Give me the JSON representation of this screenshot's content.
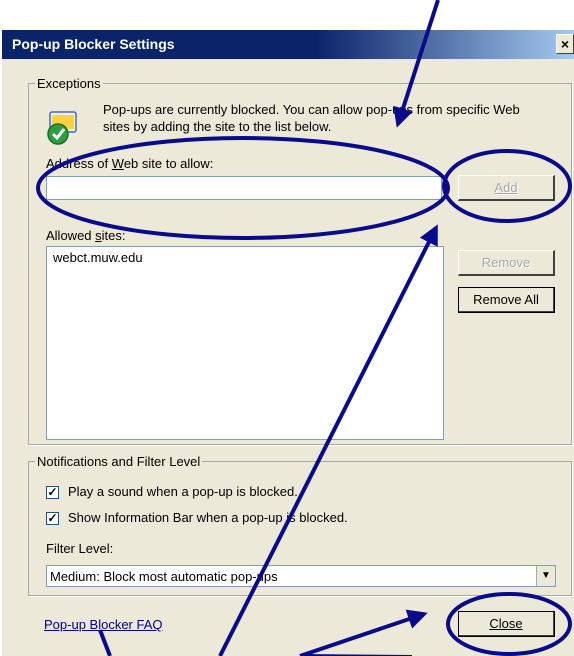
{
  "dialog": {
    "title": "Pop-up Blocker Settings",
    "close_glyph": "×"
  },
  "exceptions": {
    "legend": "Exceptions",
    "description": "Pop-ups are currently blocked.  You can allow pop-ups from specific Web sites by adding the site to the list below.",
    "address_label_pre": "Address of ",
    "address_label_accel": "W",
    "address_label_post": "eb site to allow:",
    "address_value": "",
    "add_label": "Add",
    "allowed_label_pre": "Allowed ",
    "allowed_label_accel": "s",
    "allowed_label_post": "ites:",
    "allowed_sites": [
      "webct.muw.edu"
    ],
    "remove_label": "Remove",
    "remove_all_label": "Remove All"
  },
  "notifications": {
    "legend": "Notifications and Filter Level",
    "play_sound_label": "Play a sound when a pop-up is blocked.",
    "play_sound_checked": true,
    "info_bar_label": "Show Information Bar when a pop-up is blocked.",
    "info_bar_checked": true,
    "filter_level_label": "Filter Level:",
    "filter_level_value": "Medium: Block most automatic pop-ups"
  },
  "footer": {
    "faq_link": "Pop-up Blocker FAQ",
    "close_label": "Close"
  },
  "annotation_colors": {
    "mark": "#0a0a8c"
  },
  "icons": [
    "ie-shield-check-icon",
    "checkbox-check-icon",
    "dropdown-arrow-icon",
    "close-icon"
  ]
}
